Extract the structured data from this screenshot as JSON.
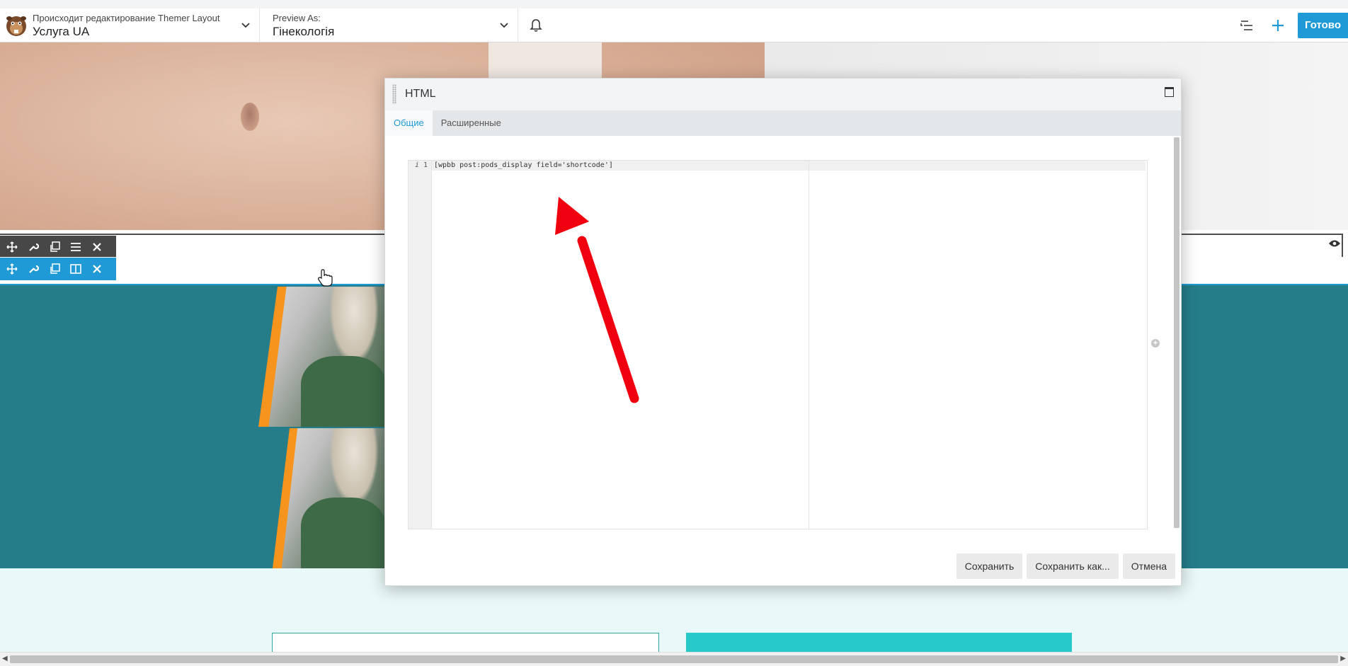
{
  "topbar": {
    "editing_label": "Происходит редактирование Themer Layout",
    "layout_name": "Услуга UA",
    "preview_label": "Preview As:",
    "preview_value": "Гінекологія",
    "done_label": "Готово"
  },
  "modal": {
    "title": "HTML",
    "tabs": [
      "Общие",
      "Расширенные"
    ],
    "active_tab": "Общие",
    "editor": {
      "line_marker": "i",
      "line_number": "1",
      "code": "[wpbb post:pods_display field='shortcode']"
    },
    "buttons": {
      "save": "Сохранить",
      "save_as": "Сохранить как...",
      "cancel": "Отмена"
    }
  },
  "colors": {
    "accent": "#1f9ad6",
    "teal_section": "#257d8a",
    "light_section": "#e9f8f8",
    "cyan_box": "#27c9c9",
    "annotation_arrow": "#f0000f",
    "orange_stripe": "#f7941d"
  },
  "icons": {
    "logo": "beaver-logo-icon",
    "chevron": "chevron-down-icon",
    "bell": "bell-icon",
    "outline": "outline-list-icon",
    "add": "plus-icon",
    "move": "move-icon",
    "settings": "wrench-icon",
    "duplicate": "duplicate-icon",
    "menu": "menu-icon",
    "columns": "columns-icon",
    "close": "close-icon",
    "visibility": "eye-icon",
    "maximize": "maximize-icon"
  }
}
